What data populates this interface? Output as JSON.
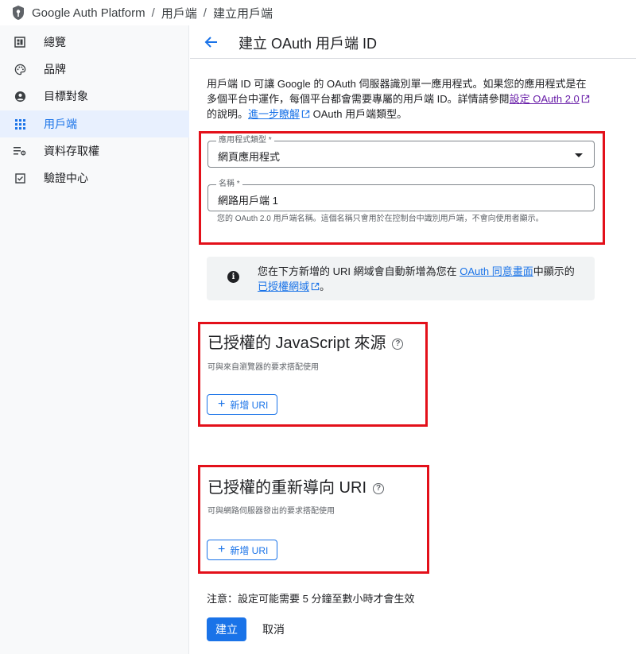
{
  "breadcrumb": {
    "items": [
      "Google Auth Platform",
      "用戶端",
      "建立用戶端"
    ],
    "separator": "/"
  },
  "sidebar": {
    "items": [
      {
        "label": "總覽",
        "icon": "dashboard-icon"
      },
      {
        "label": "品牌",
        "icon": "palette-icon"
      },
      {
        "label": "目標對象",
        "icon": "person-icon"
      },
      {
        "label": "用戶端",
        "icon": "grid-icon",
        "active": true
      },
      {
        "label": "資料存取權",
        "icon": "settings-list-icon"
      },
      {
        "label": "驗證中心",
        "icon": "check-box-icon"
      }
    ]
  },
  "header": {
    "title": "建立 OAuth 用戶端 ID"
  },
  "intro": {
    "text1": "用戶端 ID 可讓 Google 的 OAuth 伺服器識別單一應用程式。如果您的應用程式是在多個平台中運作，每個平台都會需要專屬的用戶端 ID。詳情請參閱",
    "link1": "設定 OAuth 2.0",
    "text2": " 的說明。",
    "link2": "進一步瞭解",
    "text3": " OAuth 用戶端類型。"
  },
  "form": {
    "app_type_label": "應用程式類型 *",
    "app_type_value": "網頁應用程式",
    "name_label": "名稱 *",
    "name_value": "網路用戶端 1",
    "name_helper": "您的 OAuth 2.0 用戶端名稱。這個名稱只會用於在控制台中識別用戶端，不會向使用者顯示。"
  },
  "info": {
    "text1": "您在下方新增的 URI 網域會自動新增為您在 ",
    "link1": "OAuth 同意畫面",
    "text2": "中顯示的",
    "link2": "已授權網域",
    "text3": "。"
  },
  "js_origins": {
    "title": "已授權的 JavaScript 來源",
    "subtitle": "可與來自瀏覽器的要求搭配使用",
    "add_label": "新增 URI"
  },
  "redirect_uris": {
    "title": "已授權的重新導向 URI",
    "subtitle": "可與網路伺服器發出的要求搭配使用",
    "add_label": "新增 URI"
  },
  "footer": {
    "note": "注意：設定可能需要 5 分鐘至數小時才會生效",
    "create_label": "建立",
    "cancel_label": "取消"
  },
  "colors": {
    "accent": "#1a73e8",
    "highlight_border": "#e3101a",
    "active_nav_bg": "#e8f0fe"
  }
}
